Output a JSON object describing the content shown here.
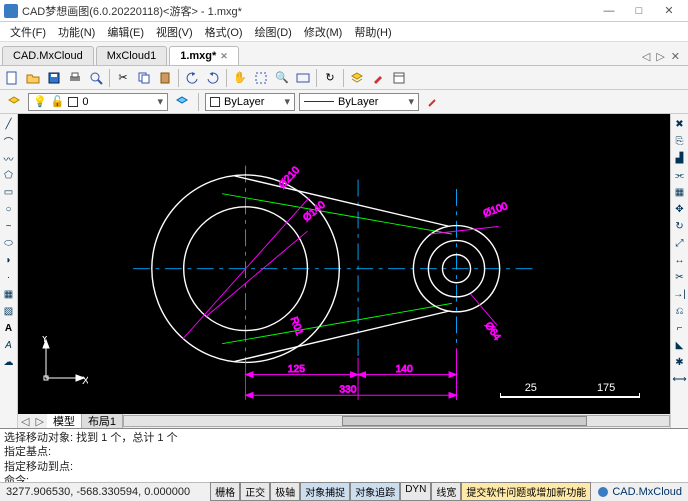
{
  "window": {
    "title": "CAD梦想画图(6.0.20220118)<游客> - 1.mxg*",
    "min": "—",
    "max": "□",
    "close": "✕"
  },
  "menu": [
    "文件(F)",
    "功能(N)",
    "编辑(E)",
    "视图(V)",
    "格式(O)",
    "绘图(D)",
    "修改(M)",
    "帮助(H)"
  ],
  "docTabs": {
    "items": [
      "CAD.MxCloud",
      "MxCloud1",
      "1.mxg*"
    ],
    "active": 2
  },
  "layerbar": {
    "layerName": "0",
    "linetype": "ByLayer",
    "lineweight": "ByLayer"
  },
  "drawing": {
    "dims": {
      "d210": "Ø210",
      "d140": "Ø140",
      "d100": "Ø100",
      "d64": "Ø64",
      "l125": "125",
      "l140": "140",
      "l330": "330",
      "r01": "R01"
    },
    "axes": {
      "y": "Y",
      "x": "X"
    },
    "scale": {
      "a": "25",
      "b": "175"
    }
  },
  "bottomTabs": [
    "模型",
    "布局1"
  ],
  "cmd": {
    "l1": "选择移动对象:  找到 1 个，总计 1 个",
    "l2": "指定基点:",
    "l3": "指定移动到点:",
    "l4": "命令:"
  },
  "status": {
    "coord": "3277.906530,  -568.330594,  0.000000",
    "btns": [
      "栅格",
      "正交",
      "极轴",
      "对象捕捉",
      "对象追踪",
      "DYN",
      "线宽"
    ],
    "on": [
      3,
      4
    ],
    "newfn": "提交软件问题或增加新功能",
    "brand": "CAD.MxCloud"
  }
}
